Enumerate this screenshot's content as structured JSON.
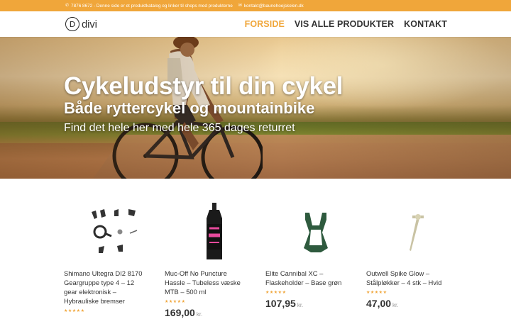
{
  "topbar": {
    "phone_icon": "phone-icon",
    "phone_text": "7876 8672 - Denne side er et produktkatalog og linker til shops med produkterne",
    "email_icon": "envelope-icon",
    "email_text": "kontakt@baunehoejskolen.dk"
  },
  "header": {
    "logo_letter": "D",
    "logo_text": "divi",
    "nav": [
      {
        "label": "FORSIDE",
        "active": true
      },
      {
        "label": "VIS ALLE PRODUKTER",
        "active": false
      },
      {
        "label": "KONTAKT",
        "active": false
      }
    ]
  },
  "hero": {
    "title": "Cykeludstyr til din cykel",
    "subtitle": "Både ryttercykel og mountainbike",
    "tagline": "Find det hele her med hele 365 dages returret"
  },
  "products": [
    {
      "name": "Shimano Ultegra DI2 8170 Geargruppe type 4 – 12 gear elektronisk – Hybrauliske bremser",
      "rating": 5,
      "price": "",
      "currency": ""
    },
    {
      "name": "Muc-Off No Puncture Hassle – Tubeless væske MTB – 500 ml",
      "rating": 5,
      "price": "169,00",
      "currency": "kr."
    },
    {
      "name": "Elite Cannibal XC – Flaskeholder – Base grøn",
      "rating": 5,
      "price": "107,95",
      "currency": "kr."
    },
    {
      "name": "Outwell Spike Glow – Stålpløkker – 4 stk – Hvid",
      "rating": 5,
      "price": "47,00",
      "currency": "kr."
    }
  ],
  "colors": {
    "accent": "#f0a63a",
    "text": "#333333"
  }
}
